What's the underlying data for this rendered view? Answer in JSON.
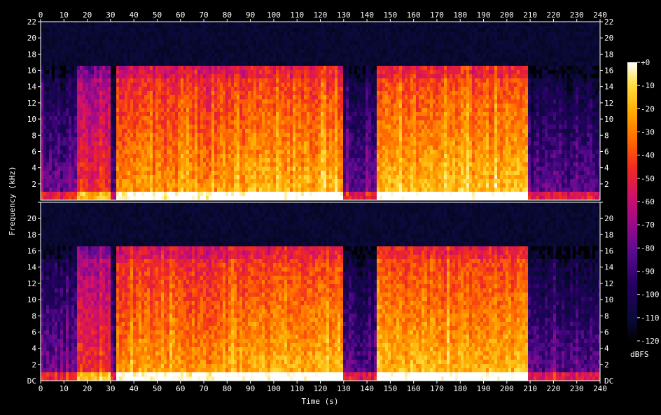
{
  "chart_data": {
    "type": "heatmap",
    "subtype": "spectrogram",
    "xlabel": "Time (s)",
    "ylabel": "Frequency (kHz)",
    "xlim": [
      0,
      240
    ],
    "x_ticks": [
      0,
      10,
      20,
      30,
      40,
      50,
      60,
      70,
      80,
      90,
      100,
      110,
      120,
      130,
      140,
      150,
      160,
      170,
      180,
      190,
      200,
      210,
      220,
      230,
      240
    ],
    "ylim_khz": [
      0,
      22
    ],
    "y_ticks": [
      2,
      4,
      6,
      8,
      10,
      12,
      14,
      16,
      18,
      20,
      22
    ],
    "y_zero_label": "DC",
    "channels": [
      {
        "name": "",
        "panel": "top"
      },
      {
        "name": "",
        "panel": "bottom"
      }
    ],
    "colorbar": {
      "unit": "dBFS",
      "range": [
        -120,
        0
      ],
      "ticks": [
        "+0",
        "-10",
        "-20",
        "-30",
        "-40",
        "-50",
        "-60",
        "-70",
        "-80",
        "-90",
        "-100",
        "-110",
        "-120"
      ],
      "colors": [
        "#000000",
        "#0a0a3a",
        "#240060",
        "#5a0a90",
        "#9a0a8a",
        "#d0106a",
        "#f02a20",
        "#ff6a00",
        "#ffaa00",
        "#ffe040",
        "#ffffff"
      ]
    },
    "loud_segments": [
      {
        "start": 32,
        "end": 80,
        "level": 0.78
      },
      {
        "start": 80,
        "end": 129,
        "level": 0.82
      },
      {
        "start": 144,
        "end": 208,
        "level": 0.84
      }
    ],
    "medium_segments": [
      {
        "start": 15,
        "end": 29,
        "level": 0.62
      },
      {
        "start": 65,
        "end": 80,
        "level": 0.55
      }
    ],
    "quiet_segments": [
      {
        "start": 0,
        "end": 15,
        "level": 0.35
      },
      {
        "start": 129,
        "end": 144,
        "level": 0.32
      },
      {
        "start": 208,
        "end": 240,
        "level": 0.3
      }
    ],
    "lowpass_cutoff_khz": 16,
    "grid": false
  }
}
